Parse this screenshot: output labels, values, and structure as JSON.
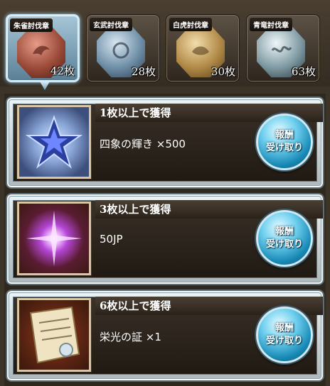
{
  "tabs": [
    {
      "label": "朱雀討伐章",
      "count": "42枚",
      "color": "#9b4a38"
    },
    {
      "label": "玄武討伐章",
      "count": "28枚",
      "color": "#6f8fa8"
    },
    {
      "label": "白虎討伐章",
      "count": "30枚",
      "color": "#b18a47"
    },
    {
      "label": "青竜討伐章",
      "count": "63枚",
      "color": "#7f9aa3"
    }
  ],
  "rewards": [
    {
      "condition": "1枚以上で獲得",
      "item": "四象の輝き ×500",
      "button": [
        "報酬",
        "受け取り"
      ]
    },
    {
      "condition": "3枚以上で獲得",
      "item": "50JP",
      "button": [
        "報酬",
        "受け取り"
      ]
    },
    {
      "condition": "6枚以上で獲得",
      "item": "栄光の証 ×1",
      "button": [
        "報酬",
        "受け取り"
      ]
    }
  ]
}
